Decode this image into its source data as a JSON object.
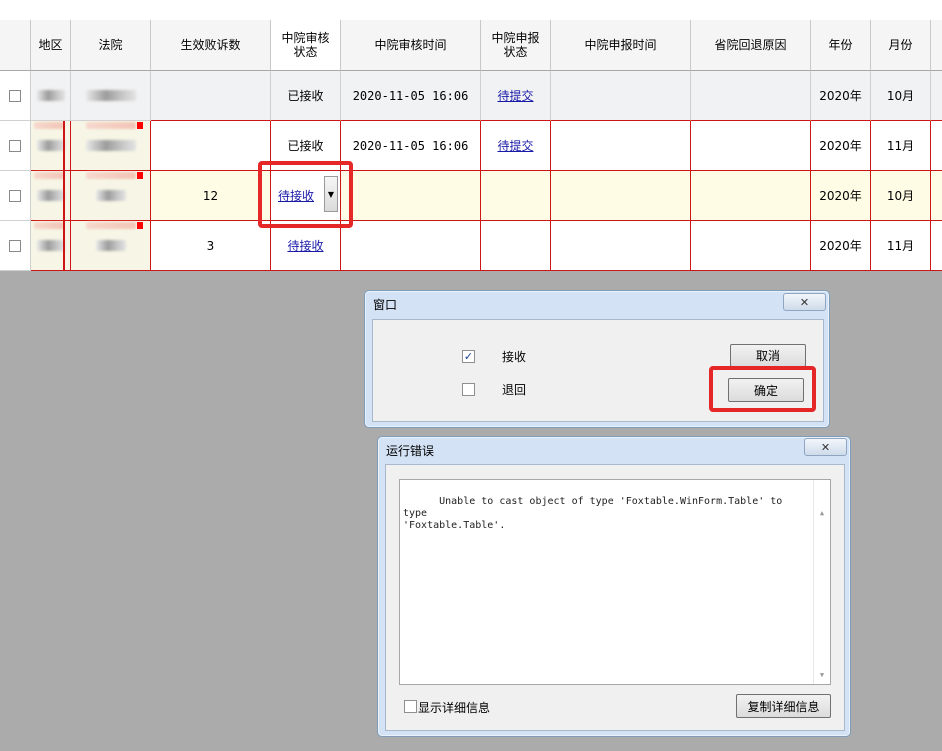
{
  "grid": {
    "headers": [
      "地区",
      "法院",
      "生效败诉数",
      "中院审核\n状态",
      "中院审核时间",
      "中院申报\n状态",
      "中院申报时间",
      "省院回退原因",
      "年份",
      "月份"
    ],
    "rows": [
      {
        "count": "",
        "review_status": "已接收",
        "review_time": "2020-11-05 16:06",
        "report_status": "待提交",
        "report_time": "",
        "reason": "",
        "year": "2020年",
        "month": "10月"
      },
      {
        "count": "",
        "review_status": "已接收",
        "review_time": "2020-11-05 16:06",
        "report_status": "待提交",
        "report_time": "",
        "reason": "",
        "year": "2020年",
        "month": "11月"
      },
      {
        "count": "12",
        "review_status": "待接收",
        "review_time": "",
        "report_status": "",
        "report_time": "",
        "reason": "",
        "year": "2020年",
        "month": "10月"
      },
      {
        "count": "3",
        "review_status": "待接收",
        "review_time": "",
        "report_status": "",
        "report_time": "",
        "reason": "",
        "year": "2020年",
        "month": "11月"
      }
    ]
  },
  "window_dialog": {
    "title": "窗口",
    "close_icon": "close-x-icon",
    "options": [
      {
        "label": "接收",
        "checked": true
      },
      {
        "label": "退回",
        "checked": false
      }
    ],
    "cancel_label": "取消",
    "ok_label": "确定"
  },
  "error_dialog": {
    "title": "运行错误",
    "message": "Unable to cast object of type 'Foxtable.WinForm.Table' to type\n'Foxtable.Table'.",
    "show_details_label": "显示详细信息",
    "copy_details_label": "复制详细信息"
  },
  "colors": {
    "highlight": "#e52727",
    "grid_line": "#cd1515",
    "link": "#1a1aa8",
    "selected_row": "#fffce6"
  }
}
